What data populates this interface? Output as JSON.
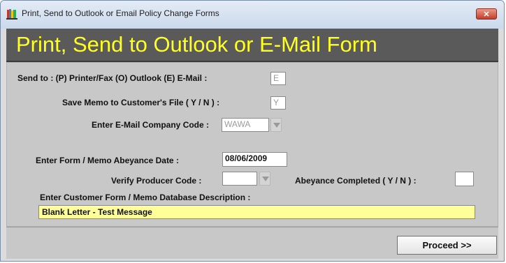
{
  "window": {
    "title": "Print, Send to Outlook or Email Policy Change Forms",
    "close_label": "✕",
    "icon": "books-app-icon"
  },
  "banner": {
    "text": "Print, Send to Outlook or E-Mail Form"
  },
  "form": {
    "send_to_label": "Send to : (P) Printer/Fax  (O) Outlook  (E) E-Mail :",
    "send_to_value": "E",
    "save_memo_label": "Save Memo to Customer's File ( Y / N ) :",
    "save_memo_value": "Y",
    "email_company_label": "Enter E-Mail Company Code :",
    "email_company_value": "WAWA",
    "abeyance_date_label": "Enter Form / Memo Abeyance Date :",
    "abeyance_date_value": "08/06/2009",
    "verify_producer_label": "Verify Producer Code :",
    "verify_producer_value": "",
    "abeyance_completed_label": "Abeyance Completed ( Y / N ) :",
    "abeyance_completed_value": "",
    "description_label": "Enter Customer Form / Memo Database Description :",
    "description_value": "Blank Letter - Test Message"
  },
  "footer": {
    "proceed_label": "Proceed >>"
  },
  "colors": {
    "banner_bg": "#5a5a5a",
    "banner_text": "#ffff22",
    "description_bg": "#ffff99"
  }
}
